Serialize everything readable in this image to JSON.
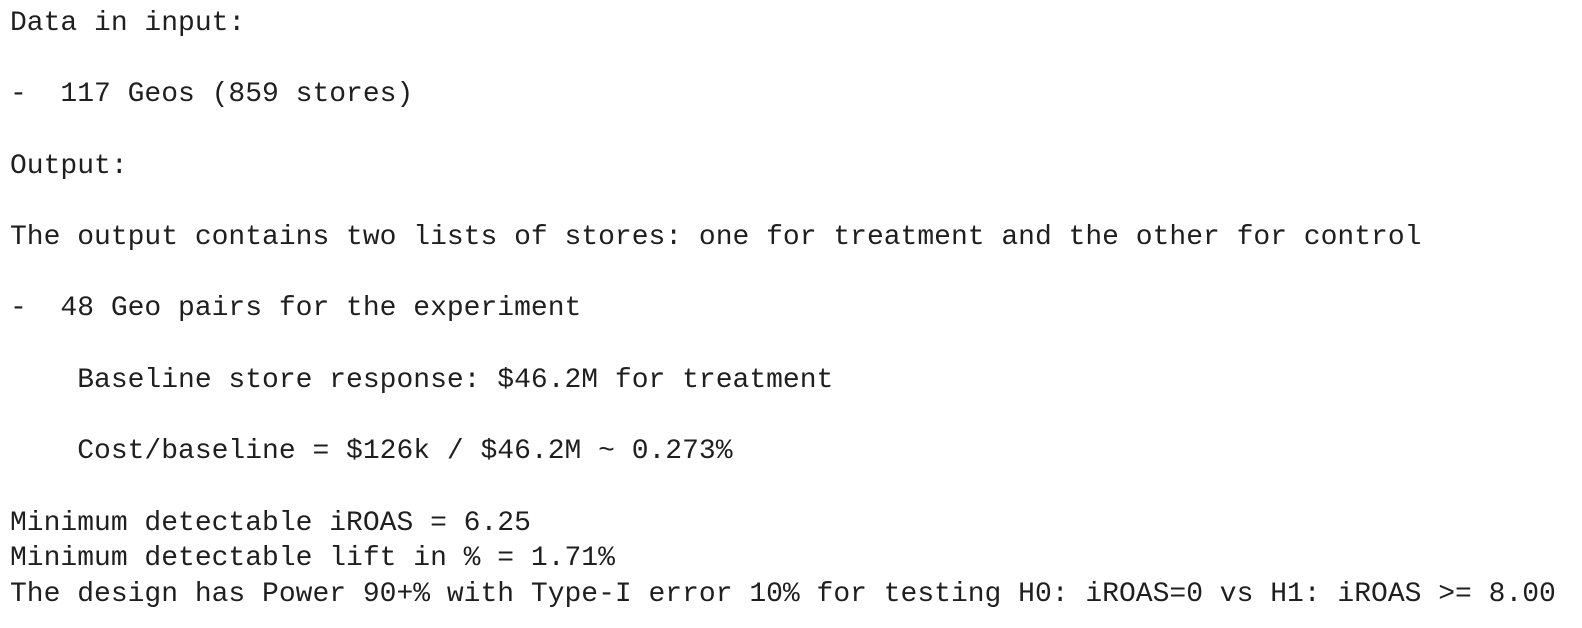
{
  "lines": {
    "data_in_input_heading": "Data in input:",
    "geos_summary": "-  117 Geos (859 stores)",
    "output_heading": "Output:",
    "output_description": "The output contains two lists of stores: one for treatment and the other for control",
    "geo_pairs": "-  48 Geo pairs for the experiment",
    "baseline_response": "    Baseline store response: $46.2M for treatment",
    "cost_baseline": "    Cost/baseline = $126k / $46.2M ~ 0.273%",
    "min_iroas": "Minimum detectable iROAS = 6.25",
    "min_lift": "Minimum detectable lift in % = 1.71%",
    "design_power": "The design has Power 90+% with Type-I error 10% for testing H0: iROAS=0 vs H1: iROAS >= 8.00"
  }
}
